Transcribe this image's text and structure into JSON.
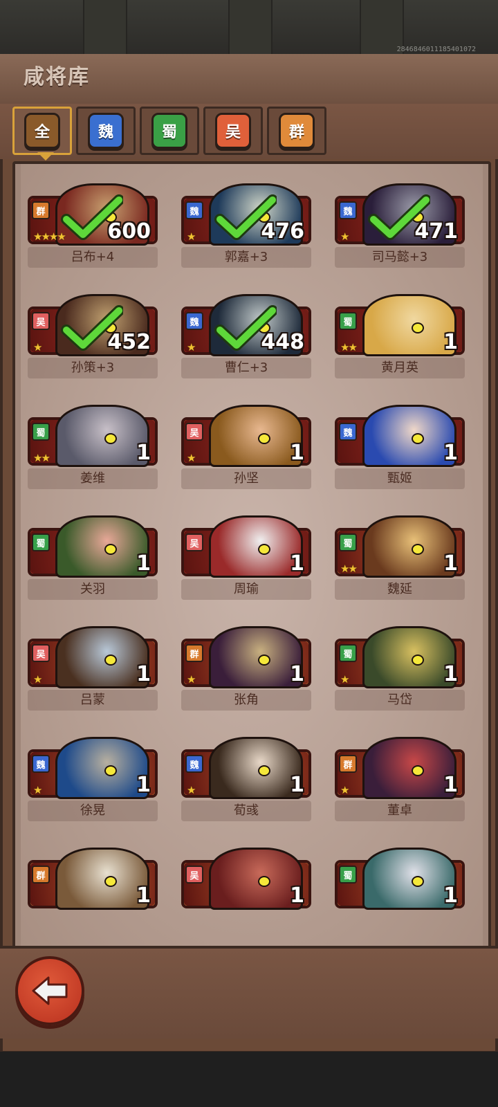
{
  "header": {
    "title": "咸将库",
    "build_id": "2846846011185401072"
  },
  "tabs": [
    {
      "label": "全",
      "color": "#8a5a2a",
      "active": true
    },
    {
      "label": "魏",
      "color": "#3a6fd0",
      "active": false
    },
    {
      "label": "蜀",
      "color": "#3aa046",
      "active": false
    },
    {
      "label": "吴",
      "color": "#e0603a",
      "active": false
    },
    {
      "label": "群",
      "color": "#e08a3a",
      "active": false
    }
  ],
  "faction_colors": {
    "群": "#d77a2d",
    "魏": "#3a68d0",
    "蜀": "#38a04a",
    "吴": "#e06060"
  },
  "heroes": [
    {
      "name": "吕布+4",
      "faction": "群",
      "count": "600",
      "stars": 4,
      "checked": true,
      "frame": "red",
      "p1": "#c8a070",
      "p2": "#7a2820"
    },
    {
      "name": "郭嘉+3",
      "faction": "魏",
      "count": "476",
      "stars": 1,
      "checked": true,
      "frame": "red",
      "p1": "#d0d6c8",
      "p2": "#1e3a5a"
    },
    {
      "name": "司马懿+3",
      "faction": "魏",
      "count": "471",
      "stars": 1,
      "checked": true,
      "frame": "red",
      "p1": "#9a9aa8",
      "p2": "#2a1e3a"
    },
    {
      "name": "孙策+3",
      "faction": "吴",
      "count": "452",
      "stars": 1,
      "checked": true,
      "frame": "red",
      "p1": "#c0a070",
      "p2": "#4a2a1e"
    },
    {
      "name": "曹仁+3",
      "faction": "魏",
      "count": "448",
      "stars": 1,
      "checked": true,
      "frame": "red",
      "p1": "#c0c8c8",
      "p2": "#1e2a3a"
    },
    {
      "name": "黄月英",
      "faction": "蜀",
      "count": "1",
      "stars": 2,
      "checked": false,
      "frame": "red",
      "p1": "#f0d8a0",
      "p2": "#d8a848"
    },
    {
      "name": "姜维",
      "faction": "蜀",
      "count": "1",
      "stars": 2,
      "checked": false,
      "frame": "red",
      "p1": "#c8c0c8",
      "p2": "#5a5a6a"
    },
    {
      "name": "孙坚",
      "faction": "吴",
      "count": "1",
      "stars": 1,
      "checked": false,
      "frame": "red",
      "p1": "#e8b890",
      "p2": "#8a5a1e"
    },
    {
      "name": "甄姬",
      "faction": "魏",
      "count": "1",
      "stars": 0,
      "checked": false,
      "frame": "red",
      "p1": "#f0d8c8",
      "p2": "#2a4ab0"
    },
    {
      "name": "关羽",
      "faction": "蜀",
      "count": "1",
      "stars": 0,
      "checked": false,
      "frame": "red",
      "p1": "#e8a898",
      "p2": "#3a5a2a"
    },
    {
      "name": "周瑜",
      "faction": "吴",
      "count": "1",
      "stars": 0,
      "checked": false,
      "frame": "red",
      "p1": "#f0f0f0",
      "p2": "#9a2a2a"
    },
    {
      "name": "魏延",
      "faction": "蜀",
      "count": "1",
      "stars": 2,
      "checked": false,
      "frame": "orange",
      "p1": "#e8c078",
      "p2": "#6a3a1e"
    },
    {
      "name": "吕蒙",
      "faction": "吴",
      "count": "1",
      "stars": 1,
      "checked": false,
      "frame": "orange",
      "p1": "#b8c8d8",
      "p2": "#4a3020"
    },
    {
      "name": "张角",
      "faction": "群",
      "count": "1",
      "stars": 1,
      "checked": false,
      "frame": "orange",
      "p1": "#c8b080",
      "p2": "#3a1e3a"
    },
    {
      "name": "马岱",
      "faction": "蜀",
      "count": "1",
      "stars": 1,
      "checked": false,
      "frame": "orange",
      "p1": "#d8c060",
      "p2": "#3a4a2a"
    },
    {
      "name": "徐晃",
      "faction": "魏",
      "count": "1",
      "stars": 1,
      "checked": false,
      "frame": "orange",
      "p1": "#b8b0a0",
      "p2": "#1e4a8a"
    },
    {
      "name": "荀彧",
      "faction": "魏",
      "count": "1",
      "stars": 1,
      "checked": false,
      "frame": "orange",
      "p1": "#e8d8c8",
      "p2": "#3a2a1e"
    },
    {
      "name": "董卓",
      "faction": "群",
      "count": "1",
      "stars": 1,
      "checked": false,
      "frame": "orange",
      "p1": "#c84848",
      "p2": "#3a1e3a"
    },
    {
      "name": "",
      "faction": "群",
      "count": "1",
      "stars": 0,
      "checked": false,
      "frame": "orange",
      "p1": "#e8e0d0",
      "p2": "#7a5a3a"
    },
    {
      "name": "",
      "faction": "吴",
      "count": "1",
      "stars": 0,
      "checked": false,
      "frame": "orange",
      "p1": "#c86a5a",
      "p2": "#6a1e1e"
    },
    {
      "name": "",
      "faction": "蜀",
      "count": "1",
      "stars": 0,
      "checked": false,
      "frame": "orange",
      "p1": "#e0e0e8",
      "p2": "#3a6a6a"
    }
  ],
  "footer": {
    "back_icon": "back-arrow-icon"
  }
}
